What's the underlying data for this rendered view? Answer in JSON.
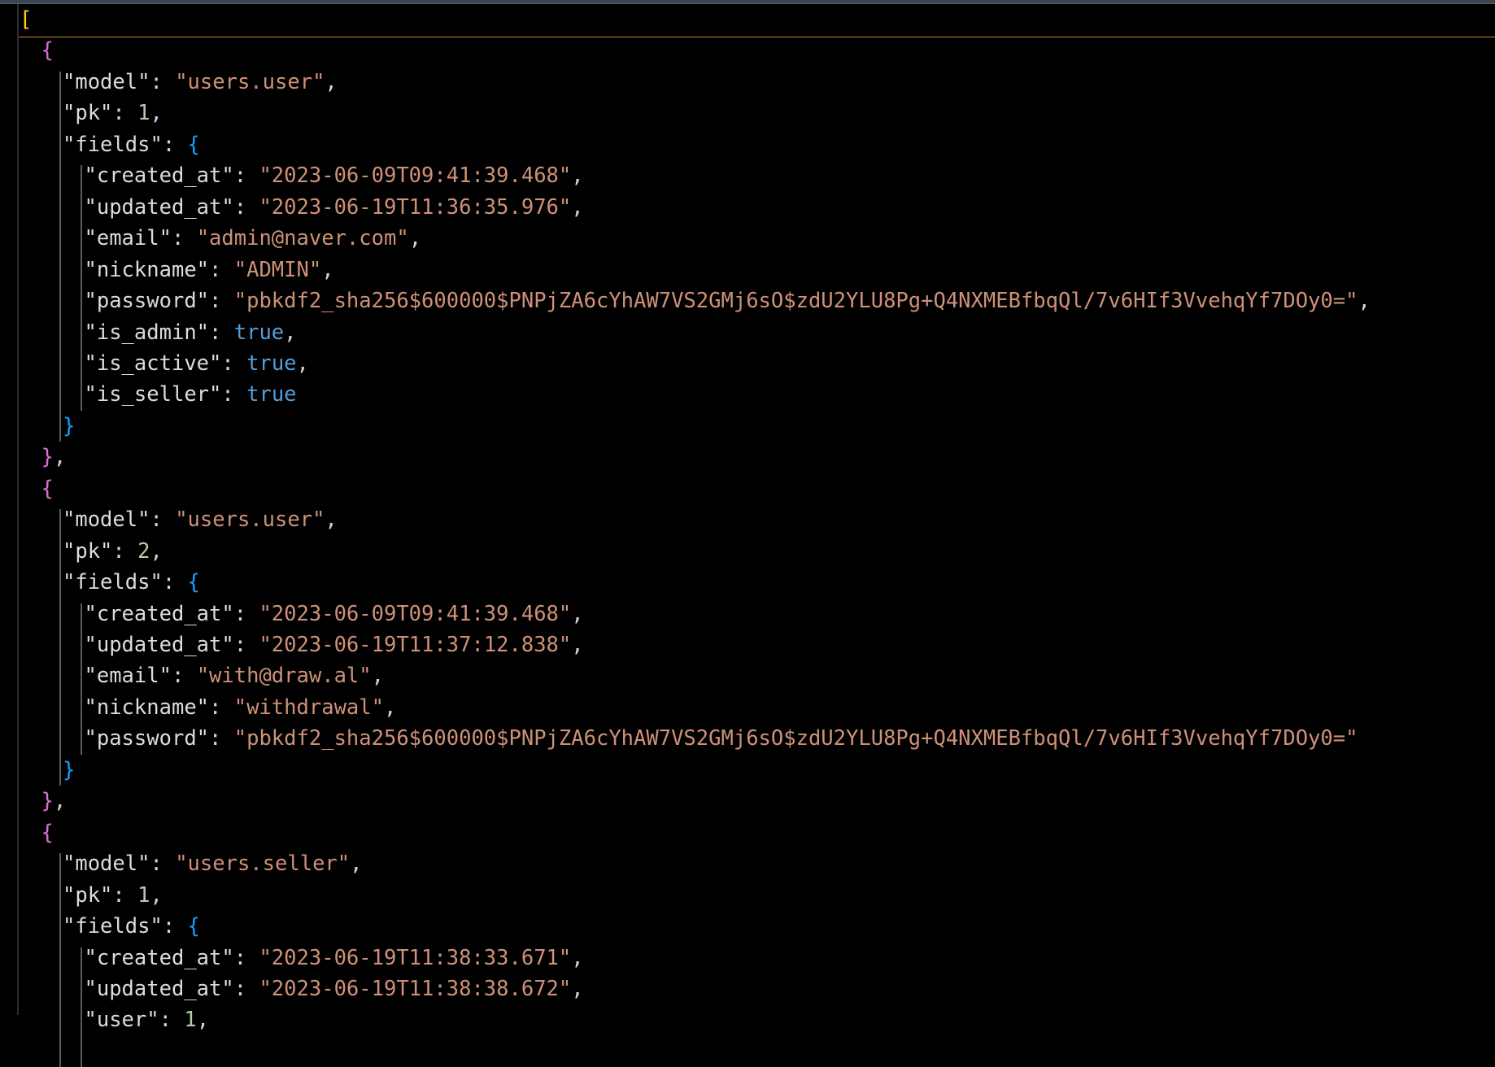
{
  "editor": {
    "language": "json",
    "colors": {
      "background": "#000000",
      "key": "#dcdcdc",
      "string": "#ce9178",
      "number": "#b5cea8",
      "boolean": "#569cd6",
      "bracket_level1": "#ffd700",
      "bracket_level2": "#da70d6",
      "bracket_level3": "#179fff",
      "current_line_border": "#c8863a"
    },
    "lines": [
      {
        "t": [
          [
            "[",
            "br-outer"
          ]
        ]
      },
      {
        "t": [
          [
            "{",
            "br-obj"
          ]
        ]
      },
      {
        "t": [
          [
            "\"model\"",
            "tok-key"
          ],
          [
            ": ",
            "tok-punc"
          ],
          [
            "\"users.user\"",
            "tok-str"
          ],
          [
            ",",
            "tok-punc"
          ]
        ]
      },
      {
        "t": [
          [
            "\"pk\"",
            "tok-key"
          ],
          [
            ": ",
            "tok-punc"
          ],
          [
            "1",
            "tok-num"
          ],
          [
            ",",
            "tok-punc"
          ]
        ]
      },
      {
        "t": [
          [
            "\"fields\"",
            "tok-key"
          ],
          [
            ": ",
            "tok-punc"
          ],
          [
            "{",
            "br-inner"
          ]
        ]
      },
      {
        "t": [
          [
            "\"created_at\"",
            "tok-key"
          ],
          [
            ": ",
            "tok-punc"
          ],
          [
            "\"2023-06-09T09:41:39.468\"",
            "tok-str"
          ],
          [
            ",",
            "tok-punc"
          ]
        ]
      },
      {
        "t": [
          [
            "\"updated_at\"",
            "tok-key"
          ],
          [
            ": ",
            "tok-punc"
          ],
          [
            "\"2023-06-19T11:36:35.976\"",
            "tok-str"
          ],
          [
            ",",
            "tok-punc"
          ]
        ]
      },
      {
        "t": [
          [
            "\"email\"",
            "tok-key"
          ],
          [
            ": ",
            "tok-punc"
          ],
          [
            "\"admin@naver.com\"",
            "tok-str"
          ],
          [
            ",",
            "tok-punc"
          ]
        ]
      },
      {
        "t": [
          [
            "\"nickname\"",
            "tok-key"
          ],
          [
            ": ",
            "tok-punc"
          ],
          [
            "\"ADMIN\"",
            "tok-str"
          ],
          [
            ",",
            "tok-punc"
          ]
        ]
      },
      {
        "t": [
          [
            "\"password\"",
            "tok-key"
          ],
          [
            ": ",
            "tok-punc"
          ],
          [
            "\"pbkdf2_sha256$600000$PNPjZA6cYhAW7VS2GMj6sO$zdU2YLU8Pg+Q4NXMEBfbqQl/7v6HIf3VvehqYf7DOy0=\"",
            "tok-str"
          ],
          [
            ",",
            "tok-punc"
          ]
        ]
      },
      {
        "t": [
          [
            "\"is_admin\"",
            "tok-key"
          ],
          [
            ": ",
            "tok-punc"
          ],
          [
            "true",
            "tok-bool"
          ],
          [
            ",",
            "tok-punc"
          ]
        ]
      },
      {
        "t": [
          [
            "\"is_active\"",
            "tok-key"
          ],
          [
            ": ",
            "tok-punc"
          ],
          [
            "true",
            "tok-bool"
          ],
          [
            ",",
            "tok-punc"
          ]
        ]
      },
      {
        "t": [
          [
            "\"is_seller\"",
            "tok-key"
          ],
          [
            ": ",
            "tok-punc"
          ],
          [
            "true",
            "tok-bool"
          ]
        ]
      },
      {
        "t": [
          [
            "}",
            "br-inner"
          ]
        ]
      },
      {
        "t": [
          [
            "}",
            "br-obj"
          ],
          [
            ",",
            "tok-punc"
          ]
        ]
      },
      {
        "t": [
          [
            "{",
            "br-obj"
          ]
        ]
      },
      {
        "t": [
          [
            "\"model\"",
            "tok-key"
          ],
          [
            ": ",
            "tok-punc"
          ],
          [
            "\"users.user\"",
            "tok-str"
          ],
          [
            ",",
            "tok-punc"
          ]
        ]
      },
      {
        "t": [
          [
            "\"pk\"",
            "tok-key"
          ],
          [
            ": ",
            "tok-punc"
          ],
          [
            "2",
            "tok-num"
          ],
          [
            ",",
            "tok-punc"
          ]
        ]
      },
      {
        "t": [
          [
            "\"fields\"",
            "tok-key"
          ],
          [
            ": ",
            "tok-punc"
          ],
          [
            "{",
            "br-inner"
          ]
        ]
      },
      {
        "t": [
          [
            "\"created_at\"",
            "tok-key"
          ],
          [
            ": ",
            "tok-punc"
          ],
          [
            "\"2023-06-09T09:41:39.468\"",
            "tok-str"
          ],
          [
            ",",
            "tok-punc"
          ]
        ]
      },
      {
        "t": [
          [
            "\"updated_at\"",
            "tok-key"
          ],
          [
            ": ",
            "tok-punc"
          ],
          [
            "\"2023-06-19T11:37:12.838\"",
            "tok-str"
          ],
          [
            ",",
            "tok-punc"
          ]
        ]
      },
      {
        "t": [
          [
            "\"email\"",
            "tok-key"
          ],
          [
            ": ",
            "tok-punc"
          ],
          [
            "\"with@draw.al\"",
            "tok-str"
          ],
          [
            ",",
            "tok-punc"
          ]
        ]
      },
      {
        "t": [
          [
            "\"nickname\"",
            "tok-key"
          ],
          [
            ": ",
            "tok-punc"
          ],
          [
            "\"withdrawal\"",
            "tok-str"
          ],
          [
            ",",
            "tok-punc"
          ]
        ]
      },
      {
        "t": [
          [
            "\"password\"",
            "tok-key"
          ],
          [
            ": ",
            "tok-punc"
          ],
          [
            "\"pbkdf2_sha256$600000$PNPjZA6cYhAW7VS2GMj6sO$zdU2YLU8Pg+Q4NXMEBfbqQl/7v6HIf3VvehqYf7DOy0=\"",
            "tok-str"
          ]
        ]
      },
      {
        "t": [
          [
            "}",
            "br-inner"
          ]
        ]
      },
      {
        "t": [
          [
            "}",
            "br-obj"
          ],
          [
            ",",
            "tok-punc"
          ]
        ]
      },
      {
        "t": [
          [
            "{",
            "br-obj"
          ]
        ]
      },
      {
        "t": [
          [
            "\"model\"",
            "tok-key"
          ],
          [
            ": ",
            "tok-punc"
          ],
          [
            "\"users.seller\"",
            "tok-str"
          ],
          [
            ",",
            "tok-punc"
          ]
        ]
      },
      {
        "t": [
          [
            "\"pk\"",
            "tok-key"
          ],
          [
            ": ",
            "tok-punc"
          ],
          [
            "1",
            "tok-num"
          ],
          [
            ",",
            "tok-punc"
          ]
        ]
      },
      {
        "t": [
          [
            "\"fields\"",
            "tok-key"
          ],
          [
            ": ",
            "tok-punc"
          ],
          [
            "{",
            "br-inner"
          ]
        ]
      },
      {
        "t": [
          [
            "\"created_at\"",
            "tok-key"
          ],
          [
            ": ",
            "tok-punc"
          ],
          [
            "\"2023-06-19T11:38:33.671\"",
            "tok-str"
          ],
          [
            ",",
            "tok-punc"
          ]
        ]
      },
      {
        "t": [
          [
            "\"updated_at\"",
            "tok-key"
          ],
          [
            ": ",
            "tok-punc"
          ],
          [
            "\"2023-06-19T11:38:38.672\"",
            "tok-str"
          ],
          [
            ",",
            "tok-punc"
          ]
        ]
      },
      {
        "t": [
          [
            "\"user\"",
            "tok-key"
          ],
          [
            ": ",
            "tok-punc"
          ],
          [
            "1",
            "tok-num"
          ],
          [
            ",",
            "tok-punc"
          ]
        ]
      }
    ]
  }
}
